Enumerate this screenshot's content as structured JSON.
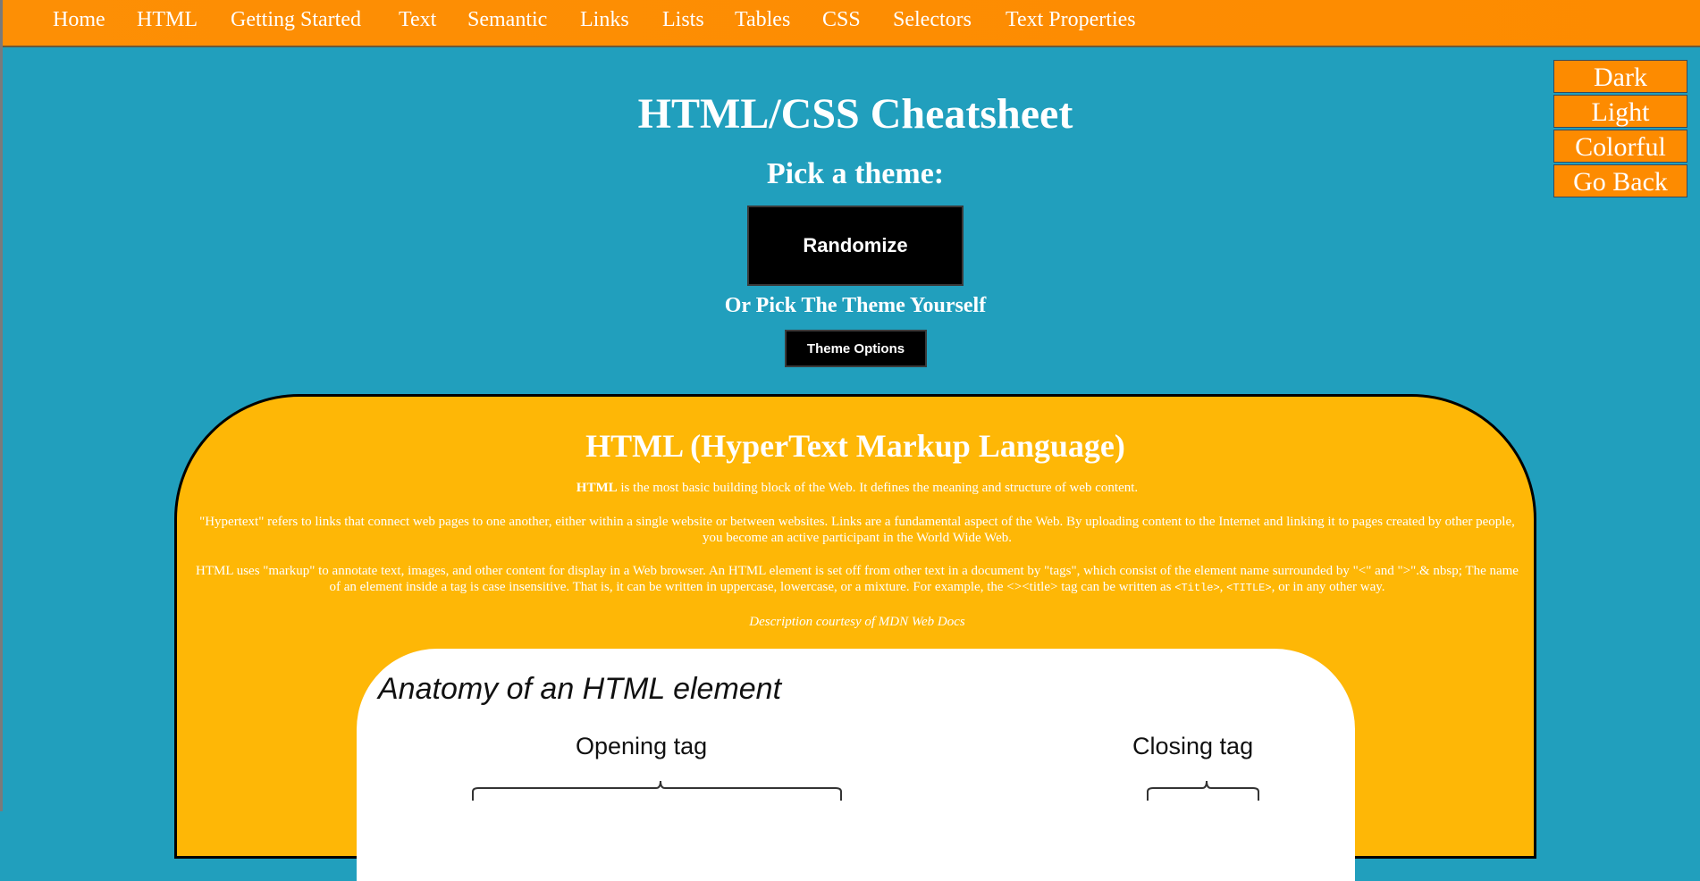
{
  "nav": {
    "items": [
      "Home",
      "HTML",
      "Getting Started",
      "Text",
      "Semantic",
      "Links",
      "Lists",
      "Tables",
      "CSS",
      "Selectors",
      "Text Properties"
    ]
  },
  "theme_panel": {
    "buttons": [
      "Dark",
      "Light",
      "Colorful",
      "Go Back"
    ]
  },
  "header": {
    "title": "HTML/CSS Cheatsheet",
    "pick_heading": "Pick a theme:",
    "randomize_label": "Randomize",
    "or_pick": "Or Pick The Theme Yourself",
    "theme_options_label": "Theme Options"
  },
  "card": {
    "title": "HTML (HyperText Markup Language)",
    "p1_bold": "HTML",
    "p1_rest": " is the most basic building block of the Web. It defines the meaning and structure of web content.",
    "p2": "\"Hypertext\" refers to links that connect web pages to one another, either within a single website or between websites. Links are a fundamental aspect of the Web. By uploading content to the Internet and linking it to pages created by other people, you become an active participant in the World Wide Web.",
    "p3_a": "HTML uses \"markup\" to annotate text, images, and other content for display in a Web browser. An HTML element is set off from other text in a document by \"tags\", which consist of the element name surrounded by \"<\" and \">\".& nbsp; The name of an element inside a tag is case insensitive. That is, it can be written in uppercase, lowercase, or a mixture. For example, the <><title> tag can be written as ",
    "p3_code1": "<Title>",
    "p3_b": ", ",
    "p3_code2": "<TITLE>",
    "p3_c": ", or in any other way.",
    "credit": "Description courtesy of MDN Web Docs"
  },
  "anatomy": {
    "title": "Anatomy of an HTML element",
    "opening_label": "Opening tag",
    "closing_label": "Closing tag"
  },
  "colors": {
    "page_bg": "#219fbd",
    "nav_bg": "#fd8b00",
    "card_bg": "#feb706",
    "button_bg": "#000000"
  }
}
